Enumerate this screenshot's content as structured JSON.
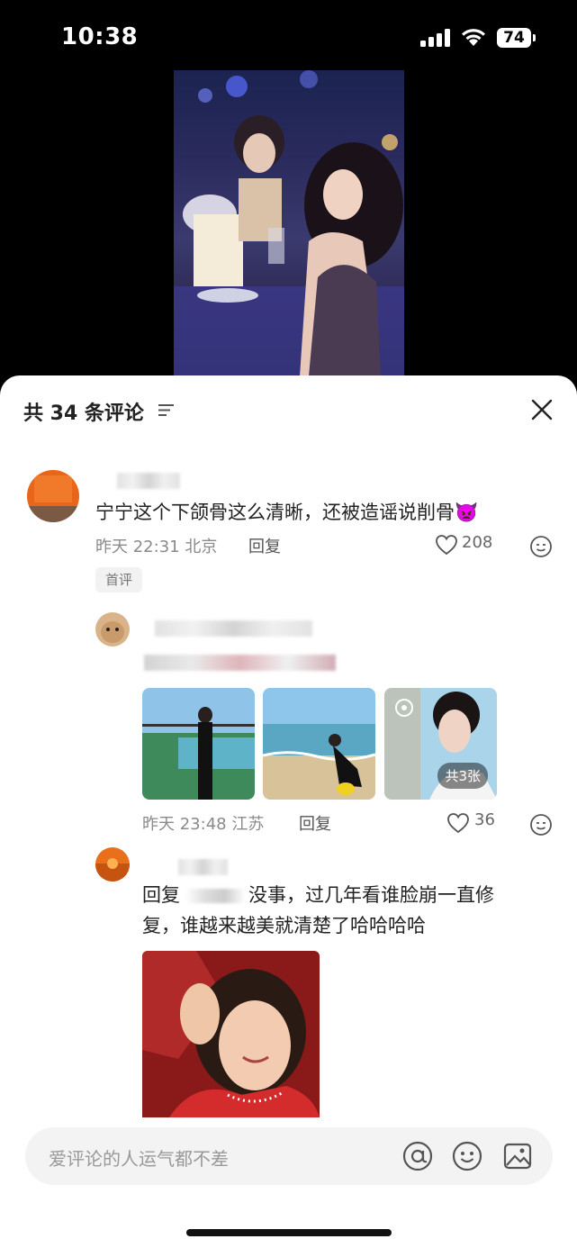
{
  "status": {
    "time": "10:38",
    "battery": "74"
  },
  "sheet": {
    "title": "共 34 条评论"
  },
  "comments": [
    {
      "text": "宁宁这个下颌骨这么清晰，还被造谣说削骨👿",
      "time": "昨天 22:31",
      "location": "北京",
      "reply_label": "回复",
      "likes": "208",
      "tag": "首评"
    }
  ],
  "replies": [
    {
      "time": "昨天 23:48",
      "location": "江苏",
      "reply_label": "回复",
      "likes": "36",
      "image_count": "共3张"
    },
    {
      "reply_prefix": "回复",
      "text_line1": "没事，过几年看谁脸崩一直修",
      "text_line2": "复，谁越来越美就清楚了哈哈哈哈"
    }
  ],
  "input": {
    "placeholder": "爱评论的人运气都不差"
  },
  "colors": {
    "sheet_bg": "#ffffff",
    "meta_gray": "#8a8a8a",
    "input_bg": "#f3f3f3"
  }
}
